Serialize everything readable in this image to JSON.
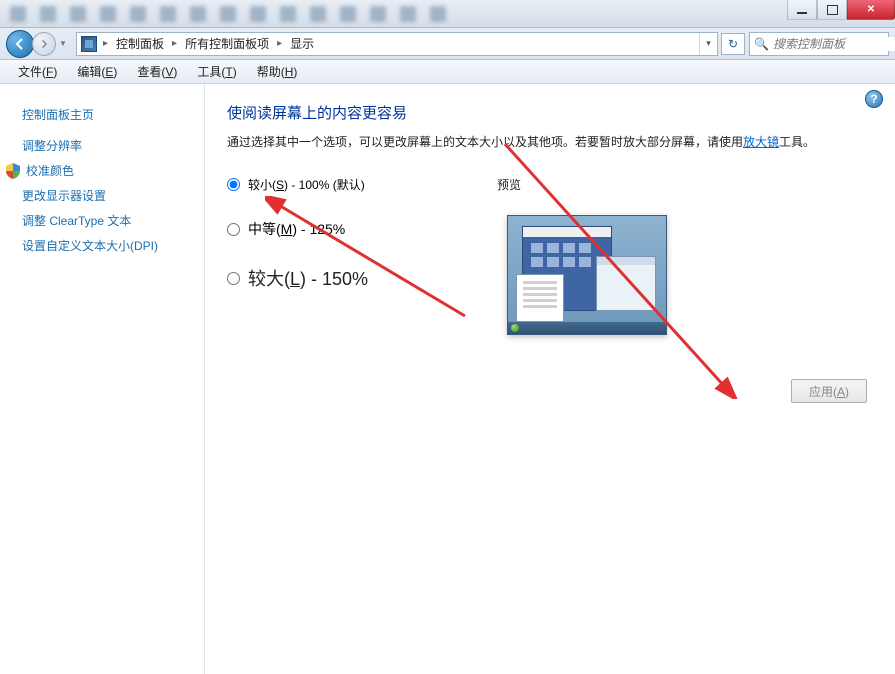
{
  "breadcrumb": {
    "item1": "控制面板",
    "item2": "所有控制面板项",
    "item3": "显示"
  },
  "search": {
    "placeholder": "搜索控制面板"
  },
  "menu": {
    "file": "文件(F)",
    "edit": "编辑(E)",
    "view": "查看(V)",
    "tools": "工具(T)",
    "help": "帮助(H)"
  },
  "sidebar": {
    "home": "控制面板主页",
    "resolution": "调整分辨率",
    "calibrate": "校准颜色",
    "displaysettings": "更改显示器设置",
    "cleartype": "调整 ClearType 文本",
    "dpi": "设置自定义文本大小(DPI)"
  },
  "content": {
    "heading": "使阅读屏幕上的内容更容易",
    "desc_pre": "通过选择其中一个选项，可以更改屏幕上的文本大小以及其他项。若要暂时放大部分屏幕，请使用",
    "magnifier": "放大镜",
    "desc_post": "工具。",
    "preview_label": "预览",
    "options": {
      "small": "较小(S) - 100% (默认)",
      "medium": "中等(M) - 125%",
      "large": "较大(L) - 150%"
    },
    "apply": "应用(A)"
  }
}
